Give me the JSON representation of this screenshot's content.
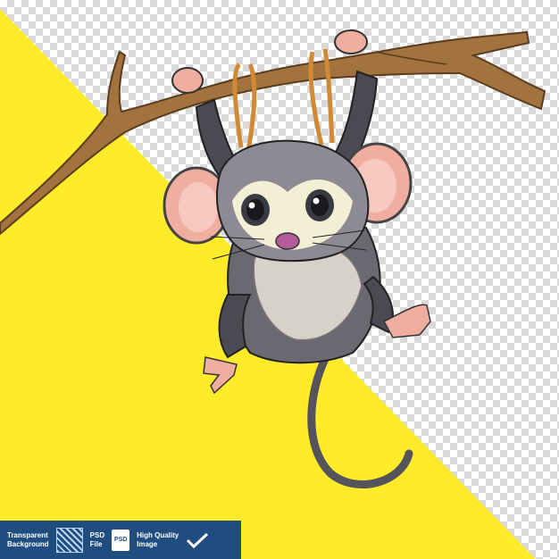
{
  "badge": {
    "transparent_line1": "Transparent",
    "transparent_line2": "Background",
    "psd_line1": "PSD",
    "psd_line2": "File",
    "psd_icon_text": "PSD",
    "hq_line1": "High Quality",
    "hq_line2": "Image"
  },
  "colors": {
    "background_yellow": "#ffeb2a",
    "badge_blue": "#1f4d80",
    "branch_brown": "#a2723f",
    "fur_gray": "#6b6872",
    "rope": "#d08a35"
  },
  "icons": [
    "transparent-grid-icon",
    "psd-file-icon",
    "checkmark-icon"
  ]
}
